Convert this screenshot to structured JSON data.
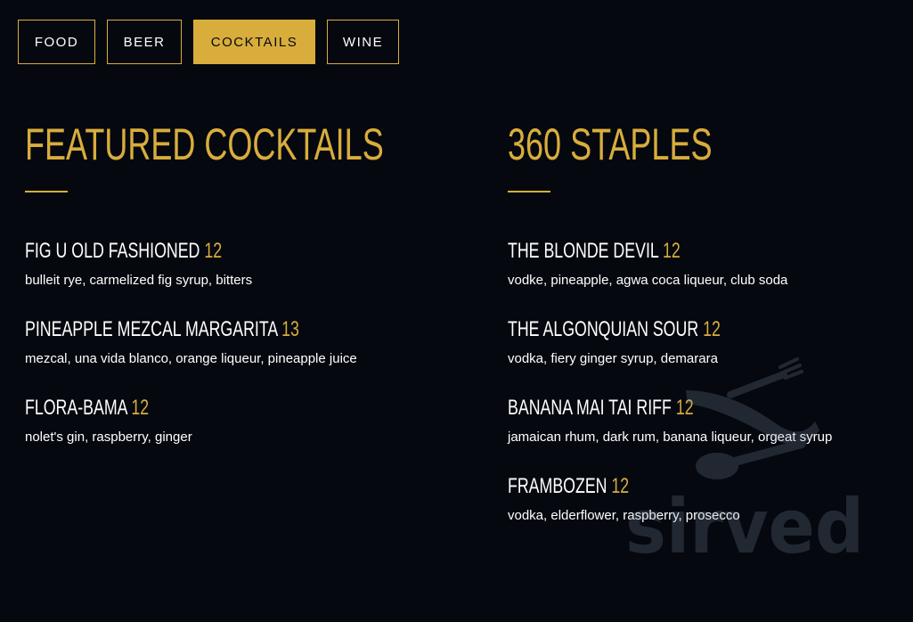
{
  "tabs": [
    {
      "label": "FOOD",
      "active": false
    },
    {
      "label": "BEER",
      "active": false
    },
    {
      "label": "COCKTAILS",
      "active": true
    },
    {
      "label": "WINE",
      "active": false
    }
  ],
  "colors": {
    "background": "#05080f",
    "accent": "#d8ad3c",
    "text": "#ffffff"
  },
  "sections": [
    {
      "title": "FEATURED COCKTAILS",
      "items": [
        {
          "name": "FIG U OLD FASHIONED",
          "price": "12",
          "description": "bulleit rye, carmelized fig syrup, bitters"
        },
        {
          "name": "PINEAPPLE MEZCAL MARGARITA",
          "price": "13",
          "description": "mezcal, una vida blanco, orange liqueur, pineapple juice"
        },
        {
          "name": "FLORA-BAMA",
          "price": "12",
          "description": "nolet's gin, raspberry, ginger"
        }
      ]
    },
    {
      "title": "360 STAPLES",
      "items": [
        {
          "name": "THE BLONDE DEVIL",
          "price": "12",
          "description": "vodke, pineapple, agwa coca liqueur, club soda"
        },
        {
          "name": "THE ALGONQUIAN SOUR",
          "price": "12",
          "description": "vodka, fiery ginger syrup, demarara"
        },
        {
          "name": "BANANA MAI TAI RIFF",
          "price": "12",
          "description": "jamaican rhum, dark rum, banana liqueur, orgeat syrup"
        },
        {
          "name": "FRAMBOZEN",
          "price": "12",
          "description": "vodka, elderflower, raspberry, prosecco"
        }
      ]
    }
  ],
  "watermark": {
    "text": "sirved",
    "icon": "knife-fork-spoon-icon"
  }
}
